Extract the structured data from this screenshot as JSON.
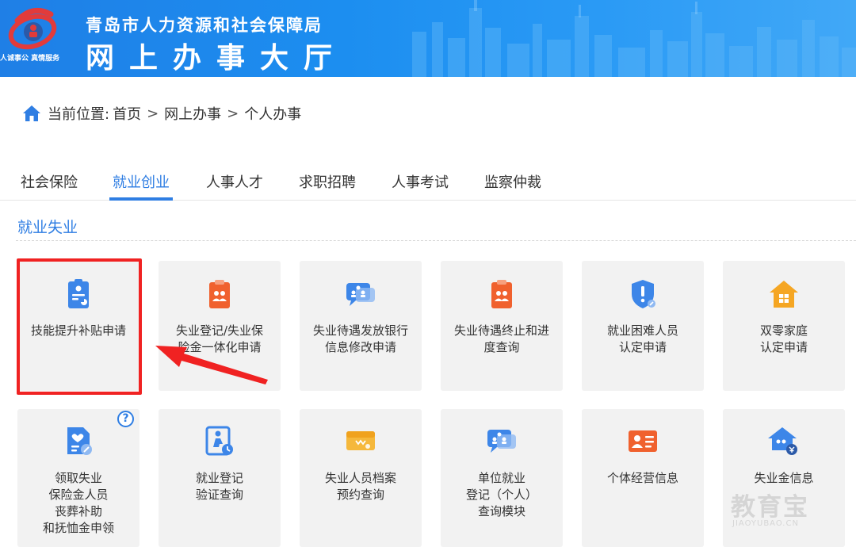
{
  "header": {
    "org_name": "青岛市人力资源和社会保障局",
    "hall_name": "网上办事大厅",
    "slogan": "人诚事公 真情服务",
    "bg_color": "#1f7fe6"
  },
  "breadcrumb": {
    "prefix": "当前位置:",
    "items": [
      "首页",
      "网上办事",
      "个人办事"
    ],
    "separator": ">"
  },
  "tabs": [
    {
      "label": "社会保险",
      "active": false
    },
    {
      "label": "就业创业",
      "active": true
    },
    {
      "label": "人事人才",
      "active": false
    },
    {
      "label": "求职招聘",
      "active": false
    },
    {
      "label": "人事考试",
      "active": false
    },
    {
      "label": "监察仲裁",
      "active": false
    }
  ],
  "section": {
    "title": "就业失业"
  },
  "cards": [
    {
      "label": "技能提升补贴申请",
      "icon": "document-chart-icon",
      "highlighted": true
    },
    {
      "label": "失业登记/失业保\n险金一体化申请",
      "icon": "clipboard-people-icon"
    },
    {
      "label": "失业待遇发放银行\n信息修改申请",
      "icon": "chat-people-icon"
    },
    {
      "label": "失业待遇终止和进\n度查询",
      "icon": "clipboard-people-icon"
    },
    {
      "label": "就业困难人员\n认定申请",
      "icon": "shield-alert-icon"
    },
    {
      "label": "双零家庭\n认定申请",
      "icon": "house-icon"
    },
    {
      "label": "领取失业\n保险金人员\n丧葬补助\n和抚恤金申领",
      "icon": "document-heart-icon",
      "help": "?"
    },
    {
      "label": "就业登记\n验证查询",
      "icon": "person-clock-icon"
    },
    {
      "label": "失业人员档案\n预约查询",
      "icon": "archive-icon"
    },
    {
      "label": "单位就业\n登记（个人）\n查询模块",
      "icon": "chat-people-icon"
    },
    {
      "label": "个体经营信息",
      "icon": "id-card-icon"
    },
    {
      "label": "失业金信息",
      "icon": "house-coin-icon"
    }
  ],
  "watermark": {
    "big": "教育宝",
    "small": "JIAOYUBAO.CN"
  },
  "colors": {
    "accent": "#2f7ee3",
    "highlight": "#f02222",
    "icon_orange": "#f0612e",
    "icon_blue": "#3d86e8",
    "icon_yellow": "#f5a623"
  }
}
